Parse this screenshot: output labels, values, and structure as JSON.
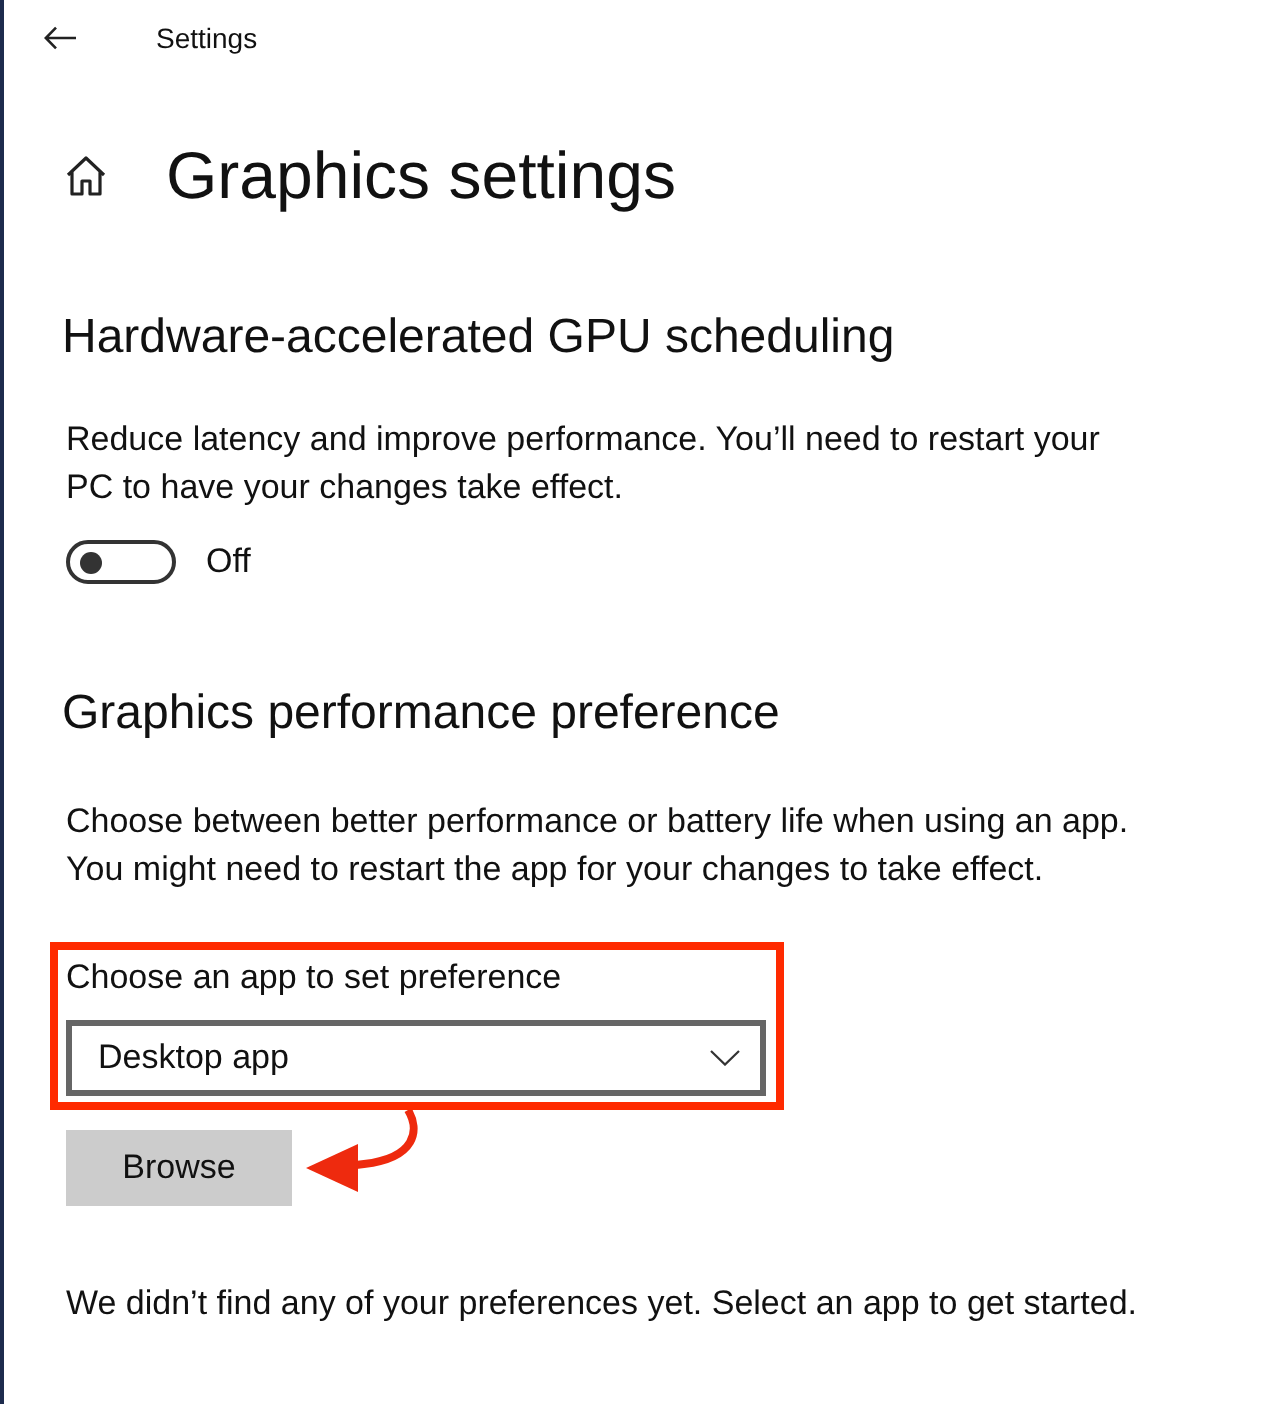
{
  "window": {
    "title": "Settings"
  },
  "page": {
    "title": "Graphics settings"
  },
  "sections": [
    {
      "kind": "toggle",
      "heading": "Hardware-accelerated GPU scheduling",
      "description": "Reduce latency and improve performance. You’ll need to restart your PC to have your changes take effect.",
      "toggle": {
        "on": false,
        "label": "Off"
      }
    },
    {
      "kind": "app-preference",
      "heading": "Graphics performance preference",
      "description": "Choose between better performance or battery life when using an app. You might need to restart the app for your changes to take effect.",
      "dropdown": {
        "label": "Choose an app to set preference",
        "value": "Desktop app",
        "highlighted": true
      },
      "button": "Browse",
      "empty_message": "We didn’t find any of your preferences yet. Select an app to get started."
    }
  ]
}
